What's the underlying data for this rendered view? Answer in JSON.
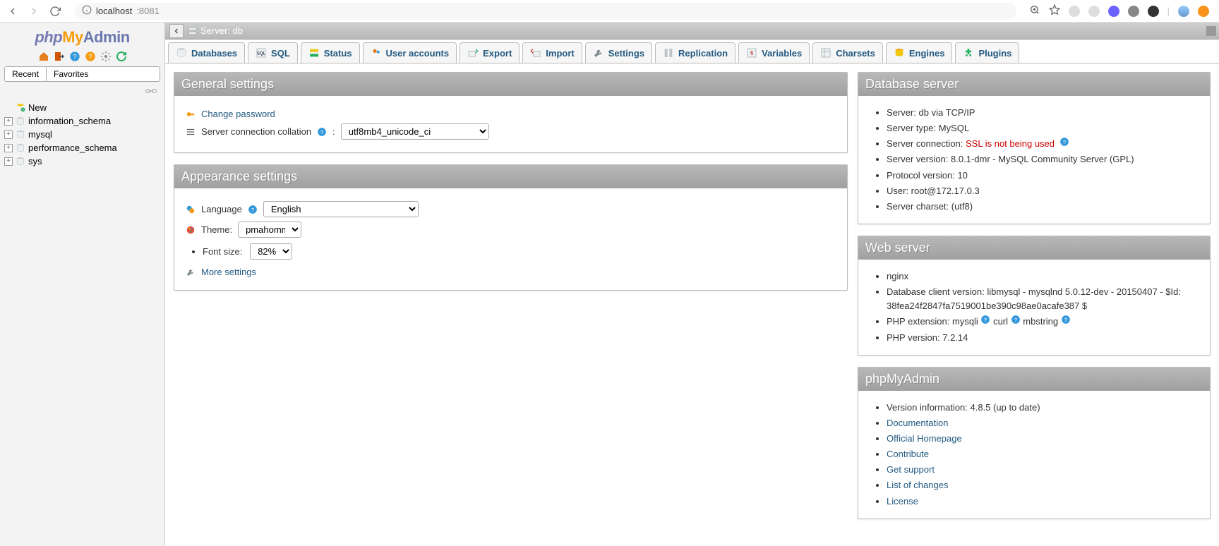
{
  "browser": {
    "url_host": "localhost",
    "url_port": ":8081"
  },
  "sidebar": {
    "tabs": {
      "recent": "Recent",
      "favorites": "Favorites"
    },
    "new": "New",
    "databases": [
      "information_schema",
      "mysql",
      "performance_schema",
      "sys"
    ]
  },
  "topbar": {
    "server_label": "Server: db"
  },
  "tabs": {
    "databases": "Databases",
    "sql": "SQL",
    "status": "Status",
    "users": "User accounts",
    "export": "Export",
    "import": "Import",
    "settings": "Settings",
    "replication": "Replication",
    "variables": "Variables",
    "charsets": "Charsets",
    "engines": "Engines",
    "plugins": "Plugins"
  },
  "general": {
    "title": "General settings",
    "change_password": "Change password",
    "collation_label": "Server connection collation",
    "collation_value": "utf8mb4_unicode_ci"
  },
  "appearance": {
    "title": "Appearance settings",
    "language_label": "Language",
    "language_value": "English",
    "theme_label": "Theme:",
    "theme_value": "pmahomme",
    "fontsize_label": "Font size:",
    "fontsize_value": "82%",
    "more_settings": "More settings"
  },
  "db_server": {
    "title": "Database server",
    "server_label": "Server: ",
    "server_value": "db via TCP/IP",
    "type_label": "Server type: ",
    "type_value": "MySQL",
    "conn_label": "Server connection: ",
    "conn_value": "SSL is not being used",
    "version_label": "Server version: ",
    "version_value": "8.0.1-dmr - MySQL Community Server (GPL)",
    "proto_label": "Protocol version: ",
    "proto_value": "10",
    "user_label": "User: ",
    "user_value": "root@172.17.0.3",
    "charset_label": "Server charset: ",
    "charset_value": "(utf8)"
  },
  "web_server": {
    "title": "Web server",
    "nginx": "nginx",
    "client_label": "Database client version: ",
    "client_value": "libmysql - mysqlnd 5.0.12-dev - 20150407 - $Id: 38fea24f2847fa7519001be390c98ae0acafe387 $",
    "ext_label": "PHP extension: ",
    "ext1": "mysqli",
    "ext2": "curl",
    "ext3": "mbstring",
    "phpver_label": "PHP version: ",
    "phpver_value": "7.2.14"
  },
  "pma": {
    "title": "phpMyAdmin",
    "version_label": "Version information: ",
    "version_value": "4.8.5 (up to date)",
    "links": {
      "docs": "Documentation",
      "home": "Official Homepage",
      "contrib": "Contribute",
      "support": "Get support",
      "changes": "List of changes",
      "license": "License"
    }
  }
}
